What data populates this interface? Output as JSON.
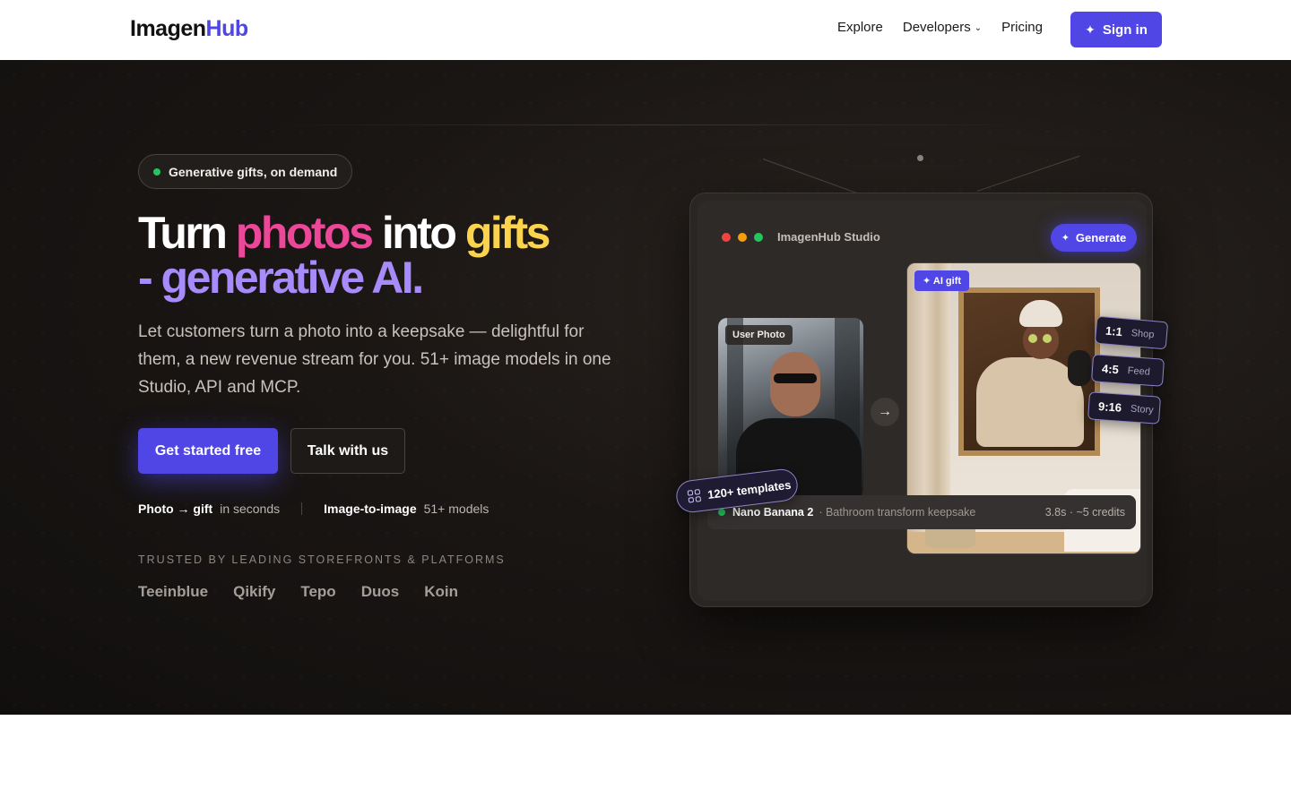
{
  "nav": {
    "logo_main": "Imagen",
    "logo_accent": "Hub",
    "links": [
      "Explore",
      "Developers",
      "Pricing"
    ],
    "developers_chevron_icon": "chevron-down-icon",
    "signin_label": "Sign in",
    "signin_icon": "sparkle-icon"
  },
  "hero": {
    "badge": "Generative gifts, on demand",
    "headline": {
      "w1": "Turn",
      "w2": "photos",
      "w3": "into",
      "w4": "gifts",
      "w5": "- generative AI."
    },
    "subtitle": "Let customers turn a photo into a keepsake — delightful for them, a new revenue stream for you. 51+ image models in one Studio, API and MCP.",
    "cta_primary": "Get started free",
    "cta_secondary": "Talk with us",
    "stats": [
      {
        "label": "Photo → gift",
        "detail": "in seconds"
      },
      {
        "label": "Image-to-image",
        "detail": "51+ models"
      }
    ],
    "trusted_heading": "TRUSTED BY LEADING STOREFRONTS & PLATFORMS",
    "brands": [
      "Teeinblue",
      "Qikify",
      "Tepo",
      "Duos",
      "Koin"
    ]
  },
  "studio": {
    "title": "ImagenHub Studio",
    "generate_label": "Generate",
    "user_photo_label": "User Photo",
    "ai_gift_label": "AI gift",
    "ratios": [
      {
        "ratio": "1:1",
        "label": "Shop"
      },
      {
        "ratio": "4:5",
        "label": "Feed"
      },
      {
        "ratio": "9:16",
        "label": "Story"
      }
    ],
    "templates_label": "120+ templates",
    "status": {
      "model": "Nano Banana 2",
      "description": "· Bathroom transform keepsake",
      "meta": "3.8s · ~5 credits"
    }
  },
  "colors": {
    "accent": "#4f46e5",
    "pink": "#ec4899",
    "yellow": "#fcd34d",
    "violet": "#a78bfa",
    "status_green": "#22c55e"
  }
}
